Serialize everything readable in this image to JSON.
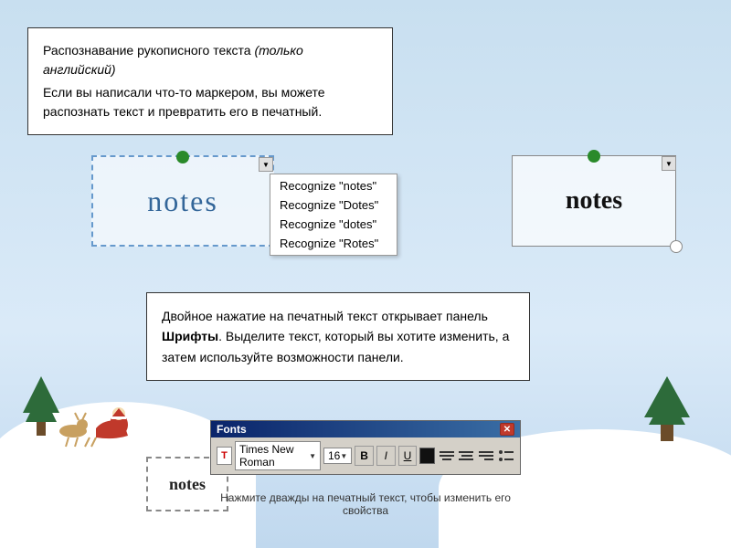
{
  "background": {
    "color_top": "#c8dff0",
    "color_bottom": "#daeaf8"
  },
  "info_box_top": {
    "title": "Распознавание рукописного текста (только английский)",
    "description": "Если вы написали что-то маркером, вы можете распознать текст и превратить его в печатный.",
    "italic_part": "только английский"
  },
  "recognition_area": {
    "handwritten_text": "notes",
    "dropdown_arrow": "▼",
    "context_menu_items": [
      "Recognize \"notes\"",
      "Recognize \"Dotes\"",
      "Recognize \"dotes\"",
      "Recognize \"Rotes\""
    ],
    "recognized_text": "notes"
  },
  "info_box_bottom": {
    "text_part1": "Двойное нажатие на печатный текст открывает панель ",
    "bold_text": "Шрифты",
    "text_part2": ". Выделите текст, который вы хотите изменить, а затем используйте возможности панели."
  },
  "fonts_toolbar": {
    "title": "Fonts",
    "close_btn": "✕",
    "font_icon": "T",
    "font_name": "Times New Roman",
    "font_size": "16",
    "bold_label": "B",
    "italic_label": "I",
    "underline_label": "U",
    "color_label": "■",
    "dropdown_arrow": "▼"
  },
  "fonts_caption": {
    "text": "Нажмите дважды на печатный текст, чтобы изменить его свойства"
  },
  "bottom_notes": {
    "text": "notes"
  }
}
